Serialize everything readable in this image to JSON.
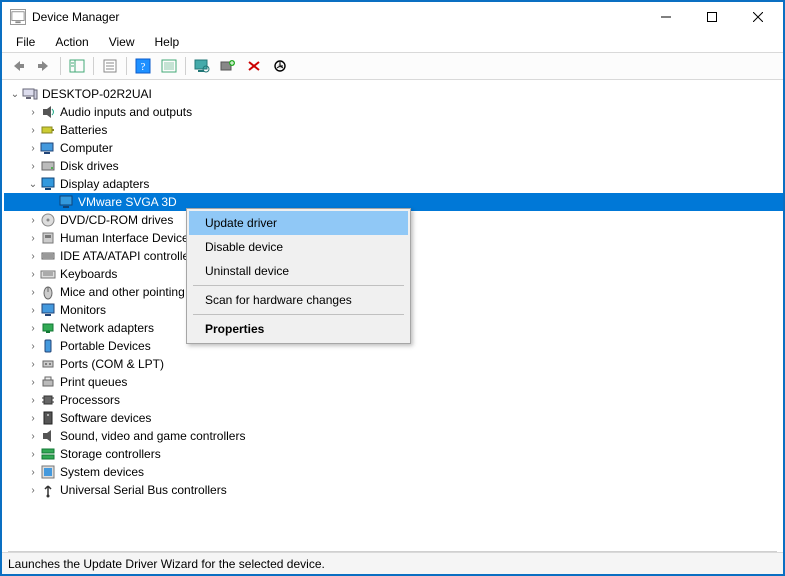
{
  "window": {
    "title": "Device Manager"
  },
  "menu": {
    "file": "File",
    "action": "Action",
    "view": "View",
    "help": "Help"
  },
  "toolbar": {
    "back": "Back",
    "forward": "Forward",
    "show_hide_tree": "Show/Hide Console Tree",
    "properties": "Properties",
    "help": "Help",
    "update": "Update driver",
    "scan_hw": "Scan for hardware changes",
    "add_legacy": "Add legacy hardware",
    "uninstall": "Uninstall device",
    "disable": "Disable device"
  },
  "tree": {
    "root": "DESKTOP-02R2UAI",
    "items": [
      {
        "label": "Audio inputs and outputs",
        "icon": "audio"
      },
      {
        "label": "Batteries",
        "icon": "battery"
      },
      {
        "label": "Computer",
        "icon": "computer"
      },
      {
        "label": "Disk drives",
        "icon": "disk"
      },
      {
        "label": "Display adapters",
        "icon": "display",
        "expanded": true,
        "children": [
          {
            "label": "VMware SVGA 3D",
            "icon": "display",
            "selected": true
          }
        ]
      },
      {
        "label": "DVD/CD-ROM drives",
        "icon": "cdrom"
      },
      {
        "label": "Human Interface Devices",
        "icon": "hid"
      },
      {
        "label": "IDE ATA/ATAPI controllers",
        "icon": "ide"
      },
      {
        "label": "Keyboards",
        "icon": "keyboard"
      },
      {
        "label": "Mice and other pointing devices",
        "icon": "mouse"
      },
      {
        "label": "Monitors",
        "icon": "monitor"
      },
      {
        "label": "Network adapters",
        "icon": "network"
      },
      {
        "label": "Portable Devices",
        "icon": "portable"
      },
      {
        "label": "Ports (COM & LPT)",
        "icon": "port"
      },
      {
        "label": "Print queues",
        "icon": "printer"
      },
      {
        "label": "Processors",
        "icon": "cpu"
      },
      {
        "label": "Software devices",
        "icon": "software"
      },
      {
        "label": "Sound, video and game controllers",
        "icon": "sound"
      },
      {
        "label": "Storage controllers",
        "icon": "storage"
      },
      {
        "label": "System devices",
        "icon": "system"
      },
      {
        "label": "Universal Serial Bus controllers",
        "icon": "usb"
      }
    ]
  },
  "context_menu": {
    "update": "Update driver",
    "disable": "Disable device",
    "uninstall": "Uninstall device",
    "scan": "Scan for hardware changes",
    "properties": "Properties"
  },
  "statusbar": {
    "text": "Launches the Update Driver Wizard for the selected device."
  },
  "icons": {
    "computer_root": "pc-icon"
  }
}
